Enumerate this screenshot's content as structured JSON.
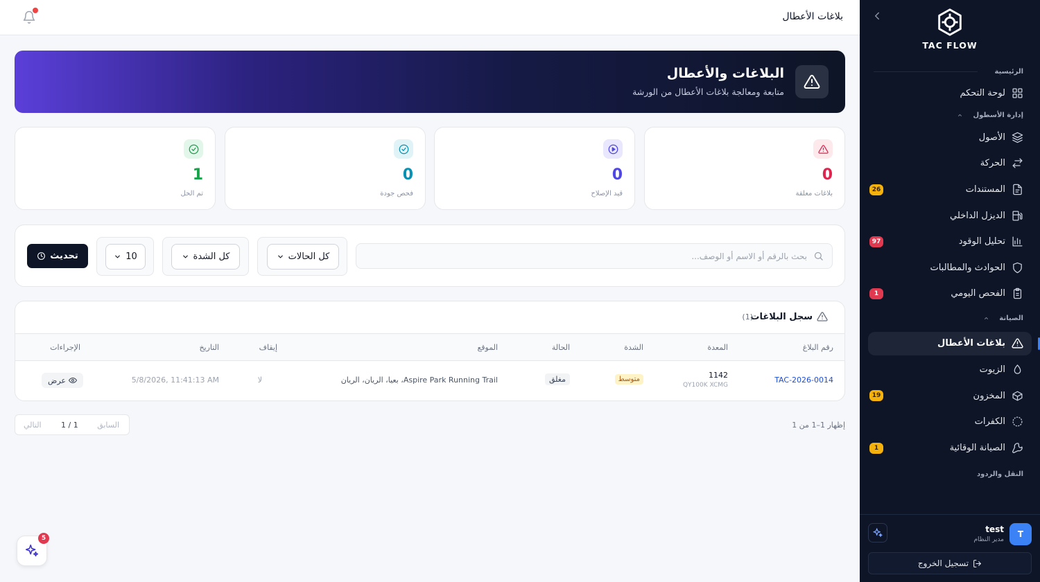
{
  "topbar": {
    "title": "بلاغات الأعطال"
  },
  "hero": {
    "title": "البلاغات والأعطال",
    "subtitle": "متابعة ومعالجة بلاغات الأعطال من الورشة"
  },
  "stats": [
    {
      "label": "بلاغات معلقة",
      "value": "0",
      "color": "#dc2650",
      "icon": "warning-triangle-icon"
    },
    {
      "label": "قيد الإصلاح",
      "value": "0",
      "color": "#4f46e5",
      "icon": "play-circle-icon"
    },
    {
      "label": "فحص جودة",
      "value": "0",
      "color": "#0891b2",
      "icon": "check-circle-icon"
    },
    {
      "label": "تم الحل",
      "value": "1",
      "color": "#16a34a",
      "icon": "check-circle-icon"
    }
  ],
  "filters": {
    "search_placeholder": "بحث بالرقم أو الاسم أو الوصف...",
    "status_select": "كل الحالات",
    "severity_select": "كل الشدة",
    "page_size": "10",
    "refresh_label": "تحديث"
  },
  "table": {
    "title": "سجل البلاغات",
    "count": "(1)",
    "headers": {
      "id": "رقم البلاغ",
      "equipment": "المعدة",
      "severity": "الشدة",
      "status": "الحالة",
      "location": "الموقع",
      "stop": "إيقاف",
      "date": "التاريخ",
      "actions": "الإجراءات"
    },
    "rows": [
      {
        "id": "TAC-2026-0014",
        "equipment": "1142",
        "equipment_sub": "QY100K XCMG",
        "severity": "متوسط",
        "status": "مغلق",
        "location": "Aspire Park Running Trail، بعيا، الريان، الريان",
        "stop": "لا",
        "date": "5/8/2026, 11:41:13 AM",
        "action": "عرض"
      }
    ]
  },
  "pagination": {
    "info": "إظهار 1–1 من 1",
    "prev": "السابق",
    "page": "1 / 1",
    "next": "التالي"
  },
  "sidebar": {
    "logo_text": "TAC FLOW",
    "sections": {
      "home": "الرئيسية",
      "fleet": "إدارة الأسطول",
      "maintenance": "الصيانة",
      "transport": "النقل والردود"
    },
    "items": {
      "dashboard": "لوحة التحكم",
      "assets": "الأصول",
      "movement": "الحركة",
      "documents": "المستندات",
      "diesel": "الديزل الداخلي",
      "fuel": "تحليل الوقود",
      "incidents": "الحوادث والمطالبات",
      "daily_check": "الفحص اليومي",
      "fault_reports": "بلاغات الأعطال",
      "oils": "الزيوت",
      "inventory": "المخزون",
      "tires": "الكفرات",
      "preventive": "الصيانة الوقائية"
    },
    "badges": {
      "documents": "26",
      "fuel": "97",
      "daily_check": "1",
      "inventory": "19",
      "preventive": "1"
    },
    "user": {
      "initial": "T",
      "name": "test",
      "role": "مدير النظام"
    },
    "logout_label": "تسجيل الخروج"
  },
  "fab_badge": "5"
}
